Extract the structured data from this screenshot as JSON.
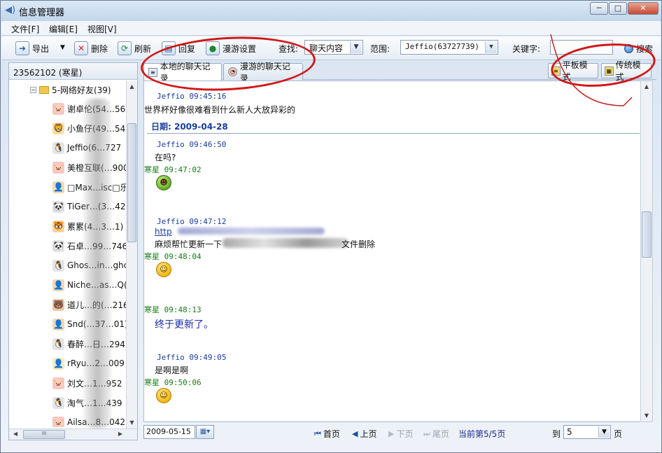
{
  "window": {
    "title": "信息管理器",
    "minimize": "─",
    "maximize": "□",
    "close": "✕"
  },
  "menu": {
    "file": "文件[F]",
    "edit": "编辑[E]",
    "view": "视图[V]"
  },
  "toolbar": {
    "export": "导出",
    "export_dropdown": "▼",
    "delete": "删除",
    "refresh": "刷新",
    "restore": "回复",
    "roaming_settings": "漫游设置",
    "find_label": "查找:",
    "find_value": "聊天内容",
    "scope_label": "范围:",
    "scope_value": "Jeffio(63727739)",
    "keyword_label": "关键字:",
    "keyword_value": "",
    "search": "搜索"
  },
  "sidebar": {
    "account": "23562102 (寒星)",
    "group": {
      "expander": "−",
      "name": "5-网络好友(39)"
    },
    "friends": [
      {
        "name": "谢卓伦(54…560",
        "avatar": "🐷",
        "color": "#f7c6c6"
      },
      {
        "name": "小鱼仔(49…542",
        "avatar": "🦁",
        "color": "#f7e0a0"
      },
      {
        "name": "Jeffio(6…727",
        "avatar": "🐧",
        "color": "#e5e5e5"
      },
      {
        "name": "美橙互联(…900",
        "avatar": "🐷",
        "color": "#f7c6c6"
      },
      {
        "name": "□Max…isc□乐",
        "avatar": "👤",
        "color": "#f3d9b1"
      },
      {
        "name": "TiGer…(3…426",
        "avatar": "🐼",
        "color": "#e5e5e5"
      },
      {
        "name": "累累(4…3…1)",
        "avatar": "🐯",
        "color": "#f7d59c"
      },
      {
        "name": "石卓…99…746",
        "avatar": "🐼",
        "color": "#e5e5e5"
      },
      {
        "name": "Ghos…in…ghc",
        "avatar": "🐧",
        "color": "#e5e5e5"
      },
      {
        "name": "Niche…as…Q(2",
        "avatar": "👤",
        "color": "#f3d9b1"
      },
      {
        "name": "道儿…的(…216",
        "avatar": "🐻",
        "color": "#e6c9a8"
      },
      {
        "name": "Snd(…37…01)",
        "avatar": "👤",
        "color": "#f3d9b1"
      },
      {
        "name": "春醉…日…294",
        "avatar": "🐧",
        "color": "#e5e5e5"
      },
      {
        "name": "rRyu…2…009",
        "avatar": "👤",
        "color": "#f5ecc0"
      },
      {
        "name": "刘文…1…952",
        "avatar": "🐷",
        "color": "#f7c6c6"
      },
      {
        "name": "淘气…1…439",
        "avatar": "🐧",
        "color": "#e5e5e5"
      },
      {
        "name": "Ailsa…8…042",
        "avatar": "🐷",
        "color": "#f7c6c6"
      }
    ],
    "hscroll_grip": "III"
  },
  "tabs": {
    "local": "本地的聊天记录",
    "roaming": "漫游的聊天记录",
    "flat_mode": "平板模式",
    "classic_mode": "传统模式"
  },
  "chat": {
    "date_label": "日期: 2009-04-28",
    "messages": [
      {
        "head": "Jeffio 09:45:16",
        "text": "世界杯好像很难看到什么新人大放异彩的"
      },
      {
        "head": "Jeffio 09:46:50",
        "text": "在吗?"
      },
      {
        "head": "寒星 09:47:02",
        "emoji": "☻"
      },
      {
        "head": "Jeffio 09:47:12",
        "link": "http",
        "text": "麻烦帮忙更新一下",
        "text_tail": "文件删除"
      },
      {
        "head": "寒星 09:48:04",
        "emoji": "☺"
      },
      {
        "head": "寒星 09:48:13",
        "text": "终于更新了。"
      },
      {
        "head": "Jeffio 09:49:05",
        "text": "是啊是啊"
      },
      {
        "head": "寒星 09:50:06",
        "emoji": "☺"
      }
    ]
  },
  "pager": {
    "date": "2009-05-15",
    "first": "首页",
    "prev": "上页",
    "next": "下页",
    "last": "尾页",
    "current": "当前第5/5页",
    "goto_label": "到",
    "goto_value": "5",
    "unit": "页"
  },
  "colors": {
    "accent": "#1a3d9c",
    "friend_name": "#1b7a1b",
    "annotation": "#d01818"
  }
}
